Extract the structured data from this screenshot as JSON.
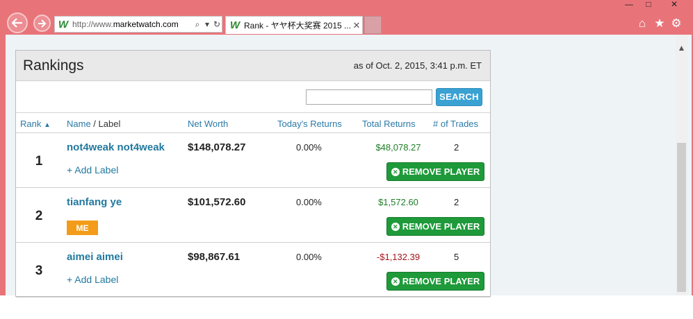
{
  "browser": {
    "url_prefix": "http://www.",
    "url_domain": "marketwatch.com",
    "tab_title": "Rank - ヤヤ杯大奖赛 2015 ...",
    "icons": [
      "back-icon",
      "forward-icon",
      "search-icon",
      "refresh-icon",
      "close-icon",
      "home-icon",
      "star-icon",
      "gear-icon"
    ]
  },
  "panel": {
    "title": "Rankings",
    "as_of": "as of Oct. 2, 2015, 3:41 p.m. ET",
    "search_placeholder": "",
    "search_label": "SEARCH"
  },
  "columns": {
    "rank": "Rank",
    "name": "Name",
    "label": "Label",
    "net_worth": "Net Worth",
    "todays_returns": "Today's Returns",
    "total_returns": "Total Returns",
    "trades": "# of Trades"
  },
  "rows": [
    {
      "rank": "1",
      "name": "not4weak not4weak",
      "sub": "+ Add Label",
      "net_worth": "$148,078.27",
      "today": "0.00%",
      "total": "$48,078.27",
      "trades": "2",
      "remove": "REMOVE PLAYER"
    },
    {
      "rank": "2",
      "name": "tianfang ye",
      "badge": "ME",
      "net_worth": "$101,572.60",
      "today": "0.00%",
      "total": "$1,572.60",
      "trades": "2",
      "remove": "REMOVE PLAYER"
    },
    {
      "rank": "3",
      "name": "aimei aimei",
      "sub": "+ Add Label",
      "net_worth": "$98,867.61",
      "today": "0.00%",
      "total": "-$1,132.39",
      "trades": "5",
      "remove": "REMOVE PLAYER"
    }
  ],
  "colors": {
    "link": "#22799f",
    "positive": "#1e7d27",
    "negative": "#a3131b",
    "remove_button": "#1e9a3a",
    "search_button": "#3aa1d3",
    "me_badge": "#f39c19"
  }
}
